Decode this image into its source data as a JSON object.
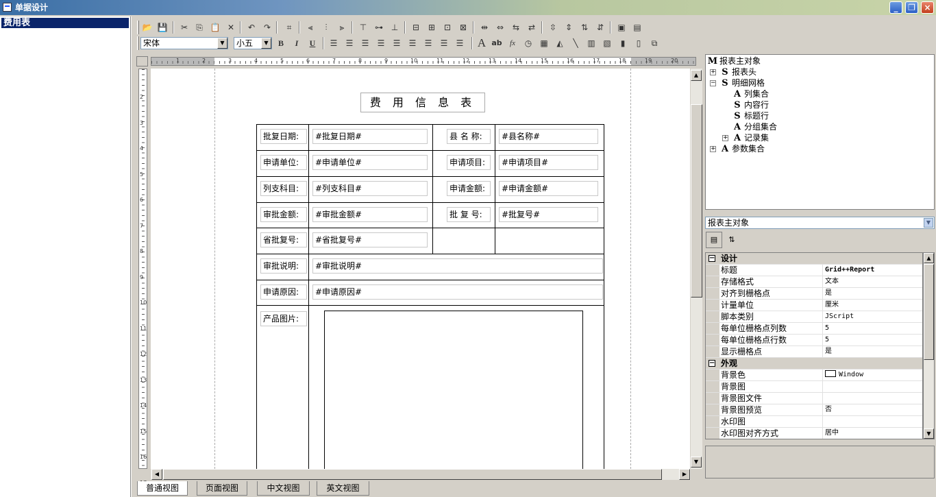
{
  "window": {
    "title": "单据设计"
  },
  "left_tree": {
    "selected_item": "费用表"
  },
  "toolbar": {
    "font_name": "宋体",
    "font_size": "小五",
    "bold_label": "B",
    "italic_label": "I",
    "underline_label": "U"
  },
  "ruler": {
    "h_numbers": [
      "1",
      "2",
      "3",
      "4",
      "5",
      "6",
      "7",
      "8",
      "9",
      "10",
      "11",
      "12",
      "13",
      "14",
      "15",
      "16",
      "17",
      "18",
      "19",
      "20"
    ],
    "v_numbers": [
      "2",
      "3",
      "4",
      "5",
      "6",
      "7",
      "8",
      "9",
      "10",
      "11",
      "12",
      "13",
      "14",
      "15",
      "16",
      "17"
    ]
  },
  "report": {
    "title": "费 用 信 息 表",
    "fields": [
      {
        "caption": "批复日期:",
        "value": "#批复日期#"
      },
      {
        "caption": "县 名 称:",
        "value": "#县名称#"
      },
      {
        "caption": "申请单位:",
        "value": "#申请单位#"
      },
      {
        "caption": "申请项目:",
        "value": "#申请项目#"
      },
      {
        "caption": "列支科目:",
        "value": "#列支科目#"
      },
      {
        "caption": "申请金额:",
        "value": "#申请金额#"
      },
      {
        "caption": "审批金额:",
        "value": "#审批金额#"
      },
      {
        "caption": "批 复 号:",
        "value": "#批复号#"
      },
      {
        "caption": "省批复号:",
        "value": "#省批复号#"
      },
      {
        "caption": "审批说明:",
        "value": "#审批说明#"
      },
      {
        "caption": "申请原因:",
        "value": "#申请原因#"
      },
      {
        "caption": "产品图片:",
        "value": ""
      }
    ]
  },
  "object_tree": [
    {
      "label": "报表主对象",
      "kind": "M"
    },
    {
      "label": "报表头",
      "kind": "S"
    },
    {
      "label": "明细网格",
      "kind": "S"
    },
    {
      "label": "列集合",
      "kind": "A"
    },
    {
      "label": "内容行",
      "kind": "S"
    },
    {
      "label": "标题行",
      "kind": "S"
    },
    {
      "label": "分组集合",
      "kind": "A"
    },
    {
      "label": "记录集",
      "kind": "A"
    },
    {
      "label": "参数集合",
      "kind": "A"
    }
  ],
  "object_selector": {
    "value": "报表主对象"
  },
  "properties": [
    {
      "name": "设计",
      "category": true
    },
    {
      "name": "标题",
      "value": "Grid++Report"
    },
    {
      "name": "存储格式",
      "value": "文本"
    },
    {
      "name": "对齐到栅格点",
      "value": "是"
    },
    {
      "name": "计量单位",
      "value": "厘米"
    },
    {
      "name": "脚本类别",
      "value": "JScript"
    },
    {
      "name": "每单位栅格点列数",
      "value": "5"
    },
    {
      "name": "每单位栅格点行数",
      "value": "5"
    },
    {
      "name": "显示栅格点",
      "value": "是"
    },
    {
      "name": "外观",
      "category": true
    },
    {
      "name": "背景色",
      "value": "Window"
    },
    {
      "name": "背景图",
      "value": ""
    },
    {
      "name": "背景图文件",
      "value": ""
    },
    {
      "name": "背景图预览",
      "value": "否"
    },
    {
      "name": "水印图",
      "value": ""
    },
    {
      "name": "水印图对齐方式",
      "value": "居中"
    }
  ],
  "view_tabs": [
    {
      "label": "普通视图"
    },
    {
      "label": "页面视图"
    },
    {
      "label": "中文视图"
    },
    {
      "label": "英文视图"
    }
  ]
}
